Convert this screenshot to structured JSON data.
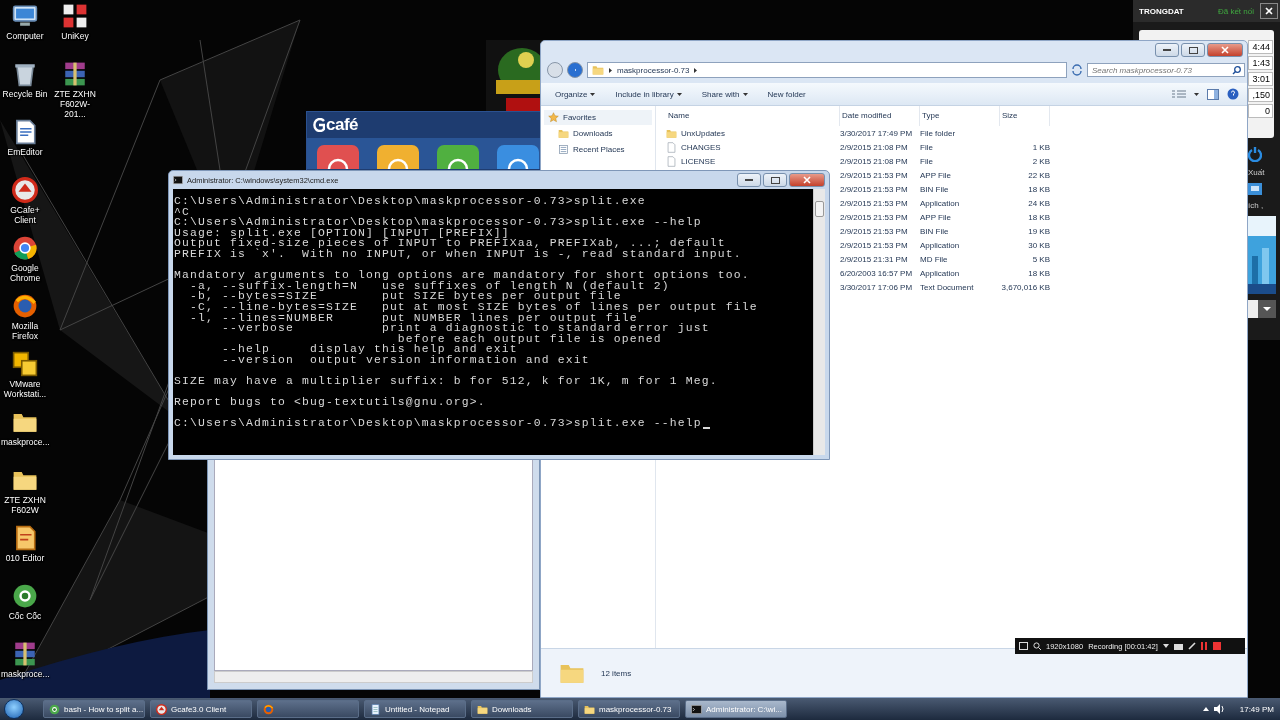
{
  "desktop_icons": [
    {
      "label": "Computer",
      "kind": "computer"
    },
    {
      "label": "Recycle Bin",
      "kind": "recycle"
    },
    {
      "label": "EmEditor",
      "kind": "emeditor"
    },
    {
      "label": "GCafe+ Client",
      "kind": "gcafe"
    },
    {
      "label": "Google Chrome",
      "kind": "chrome"
    },
    {
      "label": "Mozilla Firefox",
      "kind": "firefox"
    },
    {
      "label": "VMware Workstati...",
      "kind": "vmware"
    },
    {
      "label": "maskproce...",
      "kind": "folder"
    },
    {
      "label": "ZTE ZXHN F602W",
      "kind": "folder"
    },
    {
      "label": "010 Editor",
      "kind": "editor010"
    },
    {
      "label": "Cốc Cốc",
      "kind": "coccoc"
    },
    {
      "label": "maskproce...",
      "kind": "archive"
    },
    {
      "label": "UniKey",
      "kind": "unikey"
    },
    {
      "label": "ZTE ZXHN F602W-201...",
      "kind": "archive"
    }
  ],
  "gcafe_panel": {
    "user": "TRONGDAT",
    "status": "Đã kết nối",
    "fields": [
      "4:44",
      "1:43",
      "3:01",
      ",150",
      "0"
    ],
    "labels": [
      "Xuất",
      "ích ,"
    ]
  },
  "gcafe_window": {
    "logo": "café"
  },
  "explorer": {
    "address": "maskprocessor-0.73",
    "search_placeholder": "Search maskprocessor-0.73",
    "toolbar": [
      {
        "label": "Organize",
        "has_menu": true
      },
      {
        "label": "Include in library",
        "has_menu": true
      },
      {
        "label": "Share with",
        "has_menu": true
      },
      {
        "label": "New folder",
        "has_menu": false
      }
    ],
    "nav": [
      {
        "label": "Favorites",
        "kind": "favorites"
      },
      {
        "label": "Downloads",
        "kind": "folder"
      },
      {
        "label": "Recent Places",
        "kind": "recent"
      }
    ],
    "columns": [
      "Name",
      "Date modified",
      "Type",
      "Size"
    ],
    "rows": [
      {
        "name": "UnxUpdates",
        "kind": "folder",
        "date": "3/30/2017 17:49 PM",
        "type": "File folder"
      },
      {
        "name": "CHANGES",
        "kind": "file",
        "date": "2/9/2015 21:08 PM",
        "type": "File",
        "size": "1 KB"
      },
      {
        "name": "LICENSE",
        "kind": "file",
        "date": "2/9/2015 21:08 PM",
        "type": "File",
        "size": "2 KB"
      },
      {
        "date": "2/9/2015 21:53 PM",
        "type": "APP File",
        "size": "22 KB"
      },
      {
        "date": "2/9/2015 21:53 PM",
        "type": "BIN File",
        "size": "18 KB"
      },
      {
        "date": "2/9/2015 21:53 PM",
        "type": "Application",
        "size": "24 KB"
      },
      {
        "date": "2/9/2015 21:53 PM",
        "type": "APP File",
        "size": "18 KB"
      },
      {
        "date": "2/9/2015 21:53 PM",
        "type": "BIN File",
        "size": "19 KB"
      },
      {
        "date": "2/9/2015 21:53 PM",
        "type": "Application",
        "size": "30 KB"
      },
      {
        "date": "2/9/2015 21:31 PM",
        "type": "MD File",
        "size": "5 KB"
      },
      {
        "date": "6/20/2003 16:57 PM",
        "type": "Application",
        "size": "18 KB"
      },
      {
        "date": "3/30/2017 17:06 PM",
        "type": "Text Document",
        "size": "3,670,016 KB"
      }
    ],
    "status": "12 items"
  },
  "cmd": {
    "title": "Administrator: C:\\windows\\system32\\cmd.exe",
    "cursor_visible": true,
    "blocks": [
      [
        "C:\\Users\\Administrator\\Desktop\\maskprocessor-0.73>split.exe",
        "^C",
        "C:\\Users\\Administrator\\Desktop\\maskprocessor-0.73>split.exe --help",
        "Usage: split.exe [OPTION] [INPUT [PREFIX]]",
        "Output fixed-size pieces of INPUT to PREFIXaa, PREFIXab, ...; default",
        "PREFIX is `x'.  With no INPUT, or when INPUT is -, read standard input."
      ],
      [
        "Mandatory arguments to long options are mandatory for short options too.",
        "  -a, --suffix-length=N   use suffixes of length N (default 2)",
        "  -b, --bytes=SIZE        put SIZE bytes per output file",
        "  -C, --line-bytes=SIZE   put at most SIZE bytes of lines per output file",
        "  -l, --lines=NUMBER      put NUMBER lines per output file",
        "      --verbose           print a diagnostic to standard error just",
        "                            before each output file is opened",
        "      --help     display this help and exit",
        "      --version  output version information and exit"
      ],
      [
        "SIZE may have a multiplier suffix: b for 512, k for 1K, m for 1 Meg."
      ],
      [
        "Report bugs to <bug-textutils@gnu.org>."
      ],
      [
        "C:\\Users\\Administrator\\Desktop\\maskprocessor-0.73>split.exe --help"
      ]
    ]
  },
  "recorder": {
    "resolution": "1920x1080",
    "status": "Recording [00:01:42]"
  },
  "taskbar": {
    "items": [
      {
        "label": "bash - How to split a...",
        "kind": "coccoc",
        "selected": false
      },
      {
        "label": "Gcafe3.0 Client",
        "kind": "gcafe",
        "selected": false
      },
      {
        "kind": "firefox",
        "selected": false
      },
      {
        "label": "Untitled - Notepad",
        "kind": "notepad",
        "selected": false
      },
      {
        "label": "Downloads",
        "kind": "folder",
        "selected": false
      },
      {
        "label": "maskprocessor-0.73",
        "kind": "folder",
        "selected": false
      },
      {
        "label": "Administrator: C:\\wi...",
        "kind": "cmd",
        "selected": true
      }
    ],
    "clock": "17:49 PM"
  }
}
